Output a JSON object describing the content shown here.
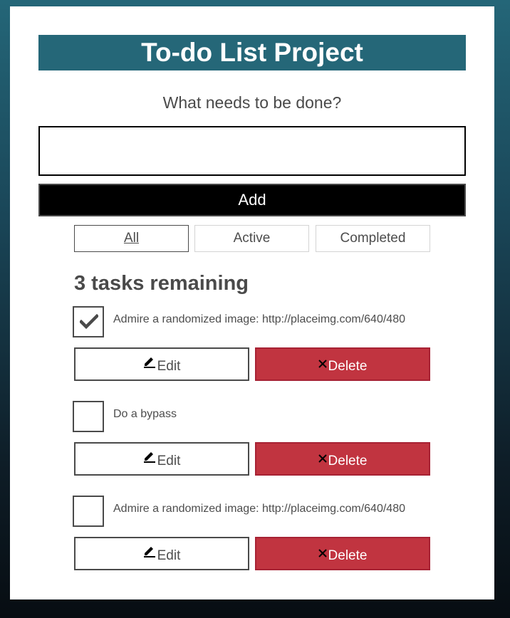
{
  "header": {
    "title": "To-do List Project"
  },
  "new_todo": {
    "label": "What needs to be done?",
    "value": "",
    "placeholder": ""
  },
  "add_button": {
    "label": "Add"
  },
  "filters": [
    {
      "label": "All",
      "pressed": true
    },
    {
      "label": "Active",
      "pressed": false
    },
    {
      "label": "Completed",
      "pressed": false
    }
  ],
  "remaining_heading": "3 tasks remaining",
  "todos": [
    {
      "text": "Admire a randomized image: http://placeimg.com/640/480",
      "checked": true,
      "edit_label": "Edit",
      "delete_label": "Delete"
    },
    {
      "text": "Do a bypass",
      "checked": false,
      "edit_label": "Edit",
      "delete_label": "Delete"
    },
    {
      "text": "Admire a randomized image: http://placeimg.com/640/480",
      "checked": false,
      "edit_label": "Edit",
      "delete_label": "Delete"
    }
  ],
  "icons": {
    "edit": "pencil-icon",
    "delete": "close-icon",
    "check": "checkmark-icon"
  },
  "colors": {
    "background_top": "#246678",
    "background_bottom": "#070d12",
    "title_bar": "#256778",
    "add_button": "#000000",
    "delete_button": "#c13440"
  }
}
